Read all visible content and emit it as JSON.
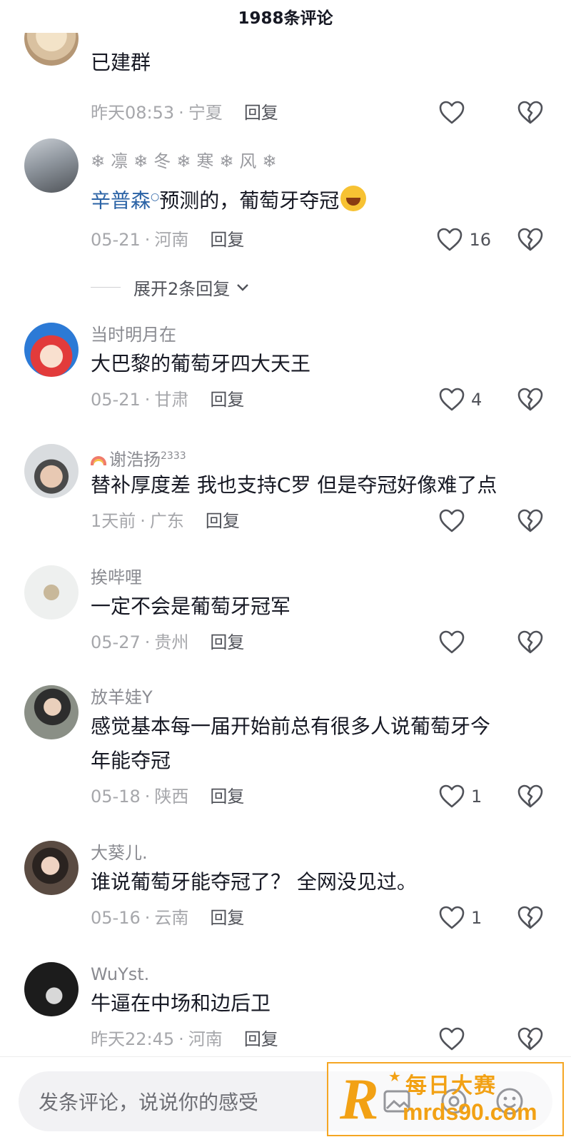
{
  "header": {
    "title": "1988条评论"
  },
  "labels": {
    "reply": "回复",
    "dot": "·"
  },
  "comments": [
    {
      "username": "",
      "text": "已建群",
      "time": "昨天08:53",
      "location": "宁夏",
      "likes": ""
    },
    {
      "username": "❄凛❄冬❄寒❄风❄",
      "mention": "辛普森",
      "text": "预测的，葡萄牙夺冠",
      "emoji": "laughing-tears-emoji",
      "time": "05-21",
      "location": "河南",
      "likes": "16"
    },
    {
      "username": "当时明月在",
      "text": "大巴黎的葡萄牙四大天王",
      "time": "05-21",
      "location": "甘肃",
      "likes": "4"
    },
    {
      "username": "谢浩扬",
      "username_prefix_icon": "rainbow-icon",
      "username_sup": "2333",
      "text": "替补厚度差 我也支持C罗 但是夺冠好像难了点",
      "time": "1天前",
      "location": "广东",
      "likes": ""
    },
    {
      "username": "挨哔哩",
      "text": "一定不会是葡萄牙冠军",
      "time": "05-27",
      "location": "贵州",
      "likes": ""
    },
    {
      "username": "放羊娃Y",
      "text_line1": "感觉基本每一届开始前总有很多人说葡萄牙今",
      "text_line2": "年能夺冠",
      "time": "05-18",
      "location": "陕西",
      "likes": "1"
    },
    {
      "username": "大葵儿.",
      "text": "谁说葡萄牙能夺冠了？ 全网没见过。",
      "time": "05-16",
      "location": "云南",
      "likes": "1"
    },
    {
      "username": "WuYst.",
      "text": "牛逼在中场和边后卫",
      "time": "昨天22:45",
      "location": "河南",
      "likes": ""
    }
  ],
  "expand_replies": {
    "label": "展开2条回复"
  },
  "input": {
    "placeholder": "发条评论，说说你的感受"
  },
  "watermark": {
    "letter": "R",
    "star": "★",
    "name": "每日大赛",
    "url": "mrds90.com"
  },
  "colors": {
    "accent": "#f2a114",
    "mention": "#2b63a6"
  }
}
